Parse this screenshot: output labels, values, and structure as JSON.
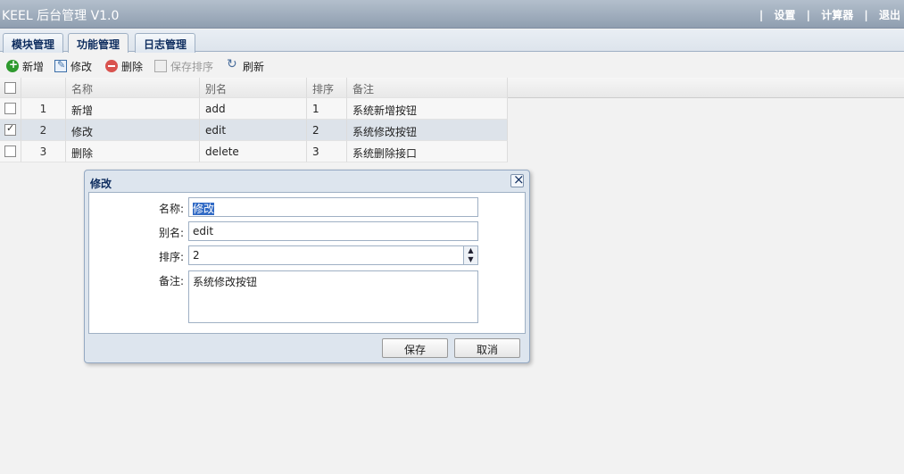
{
  "header": {
    "title": "KEEL 后台管理 V1.0",
    "links": [
      "设置",
      "计算器",
      "退出"
    ]
  },
  "tabs": [
    {
      "label": "模块管理",
      "active": false
    },
    {
      "label": "功能管理",
      "active": true
    },
    {
      "label": "日志管理",
      "active": false
    }
  ],
  "toolbar": {
    "add": "新增",
    "edit": "修改",
    "delete": "删除",
    "save_order": "保存排序",
    "refresh": "刷新"
  },
  "grid": {
    "columns": [
      "名称",
      "别名",
      "排序",
      "备注"
    ],
    "rows": [
      {
        "num": "1",
        "name": "新增",
        "alias": "add",
        "order": "1",
        "remark": "系统新增按钮",
        "checked": false
      },
      {
        "num": "2",
        "name": "修改",
        "alias": "edit",
        "order": "2",
        "remark": "系统修改按钮",
        "checked": true
      },
      {
        "num": "3",
        "name": "删除",
        "alias": "delete",
        "order": "3",
        "remark": "系统删除接口",
        "checked": false
      }
    ]
  },
  "dialog": {
    "title": "修改",
    "fields": {
      "name_label": "名称:",
      "name_value": "修改",
      "alias_label": "别名:",
      "alias_value": "edit",
      "order_label": "排序:",
      "order_value": "2",
      "remark_label": "备注:",
      "remark_value": "系统修改按钮"
    },
    "save": "保存",
    "cancel": "取消"
  },
  "colors": {
    "header": "#8f9eb0",
    "selected_row": "#dde3ea",
    "dialog_bg": "#dde5ee"
  }
}
